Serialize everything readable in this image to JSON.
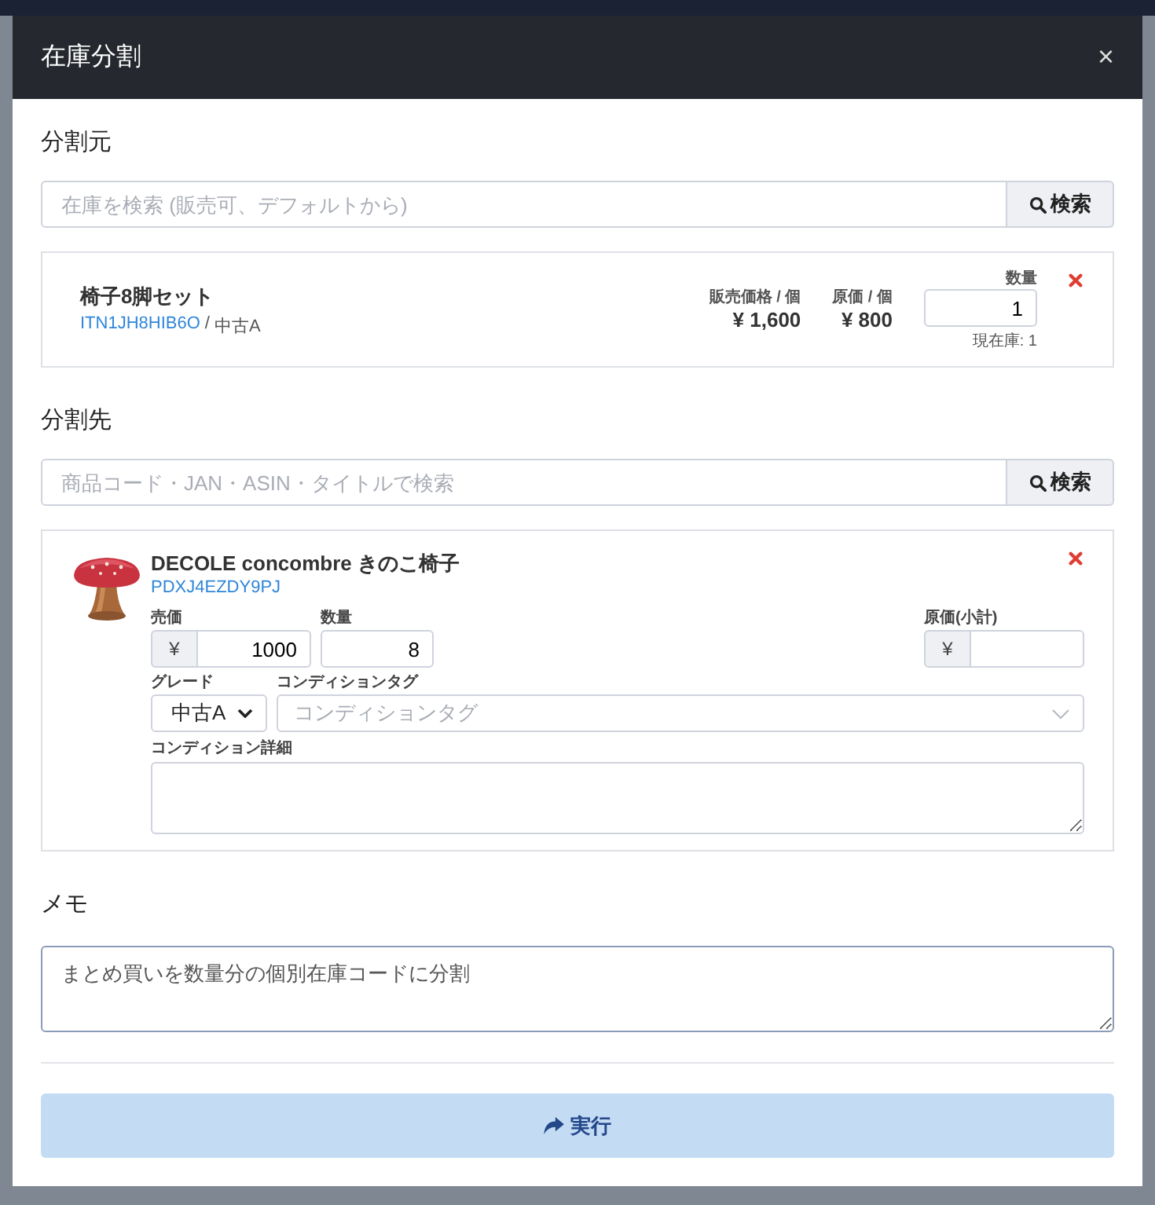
{
  "modal": {
    "title": "在庫分割",
    "close": "×"
  },
  "source": {
    "heading": "分割元",
    "search": {
      "placeholder": "在庫を検索 (販売可、デフォルトから)",
      "button": "検索"
    },
    "item": {
      "name": "椅子8脚セット",
      "code": "ITN1JH8HIB6O",
      "separator": "/",
      "grade": "中古A",
      "price_label": "販売価格 / 個",
      "price": "¥ 1,600",
      "cost_label": "原価 / 個",
      "cost": "¥ 800",
      "qty_label": "数量",
      "qty": "1",
      "stock": "現在庫: 1"
    }
  },
  "target": {
    "heading": "分割先",
    "search": {
      "placeholder": "商品コード・JAN・ASIN・タイトルで検索",
      "button": "検索"
    },
    "item": {
      "name": "DECOLE concombre きのこ椅子",
      "code": "PDXJ4EZDY9PJ",
      "price_label": "売価",
      "currency": "¥",
      "price": "1000",
      "qty_label": "数量",
      "qty": "8",
      "cost_label": "原価(小計)",
      "cost_currency": "¥",
      "grade_label": "グレード",
      "grade": "中古A",
      "tag_label": "コンディションタグ",
      "tag_placeholder": "コンディションタグ",
      "detail_label": "コンディション詳細"
    }
  },
  "memo": {
    "heading": "メモ",
    "value": "まとめ買いを数量分の個別在庫コードに分割"
  },
  "submit": {
    "label": "実行",
    "disabled": true
  }
}
